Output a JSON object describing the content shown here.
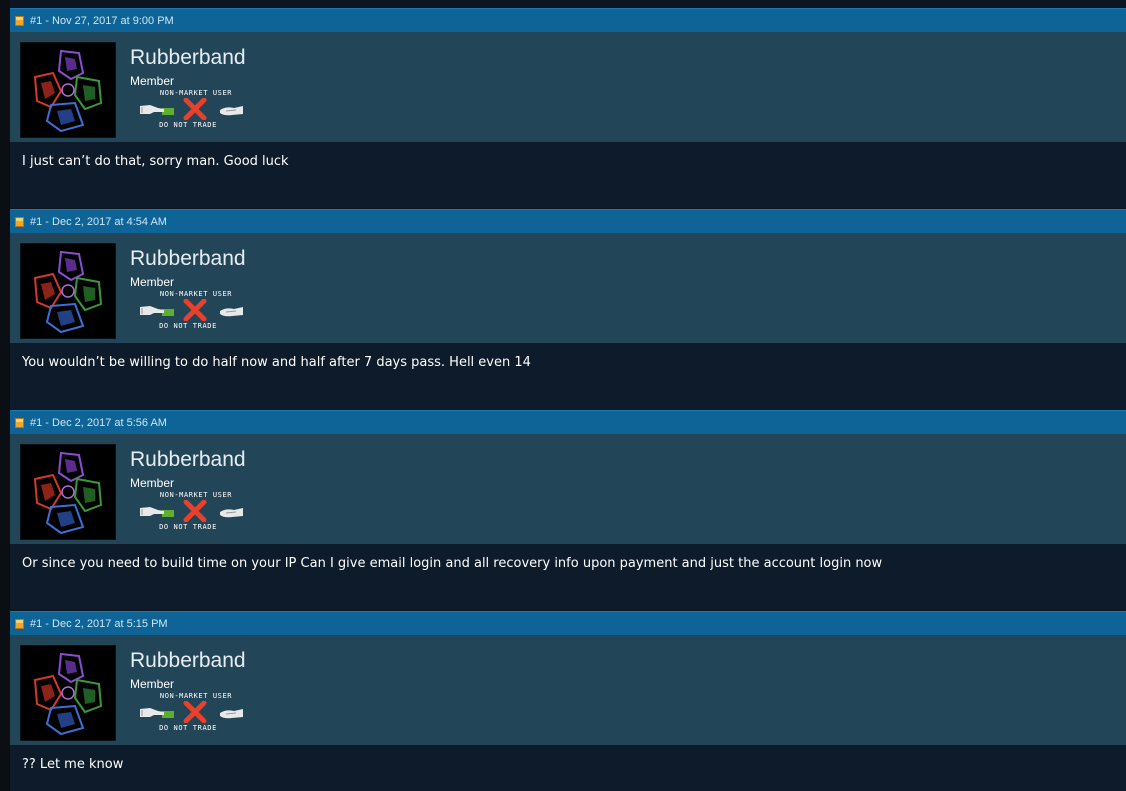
{
  "posts": [
    {
      "header": "#1 - Nov 27, 2017 at 9:00 PM",
      "username": "Rubberband",
      "user_title": "Member",
      "badge_top": "NON-MARKET USER",
      "badge_bottom": "DO NOT TRADE",
      "message": "I just can’t do that, sorry man. Good luck"
    },
    {
      "header": "#1 - Dec 2, 2017 at 4:54 AM",
      "username": "Rubberband",
      "user_title": "Member",
      "badge_top": "NON-MARKET USER",
      "badge_bottom": "DO NOT TRADE",
      "message": "You wouldn’t be willing to do half now and half after 7 days pass. Hell even 14"
    },
    {
      "header": "#1 - Dec 2, 2017 at 5:56 AM",
      "username": "Rubberband",
      "user_title": "Member",
      "badge_top": "NON-MARKET USER",
      "badge_bottom": "DO NOT TRADE",
      "message": "Or since you need to build time on your IP Can I give email login and all recovery info upon payment and just the account login now"
    },
    {
      "header": "#1 - Dec 2, 2017 at 5:15 PM",
      "username": "Rubberband",
      "user_title": "Member",
      "badge_top": "NON-MARKET USER",
      "badge_bottom": "DO NOT TRADE",
      "message": "?? Let me know"
    }
  ],
  "icons": {
    "header": "note-icon",
    "badge": [
      "hand-with-cash-icon",
      "red-x-icon",
      "open-hand-icon"
    ]
  },
  "colors": {
    "header_bg": "#0e6497",
    "meta_bg": "#234558",
    "body_bg": "#0d1b2a",
    "cash_green": "#5fae2e",
    "x_red": "#e8412b"
  }
}
